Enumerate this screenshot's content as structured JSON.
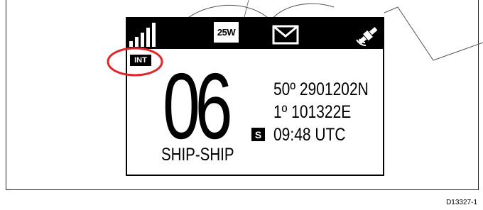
{
  "status_bar": {
    "power_label": "25W",
    "signal_icon": "signal-bars-icon",
    "mail_icon": "envelope-icon",
    "gps_icon": "satellite-icon"
  },
  "channel_mode": "INT",
  "channel": {
    "number": "06",
    "name": "SHIP-SHIP"
  },
  "position": {
    "latitude": "50º 2901202N",
    "longitude": "1º 101322E",
    "time_badge": "S",
    "time": "09:48 UTC"
  },
  "figure_code": "D13327-1",
  "colors": {
    "highlight": "#e0262b",
    "screen_bg": "#ffffff",
    "bar_bg": "#000000"
  }
}
